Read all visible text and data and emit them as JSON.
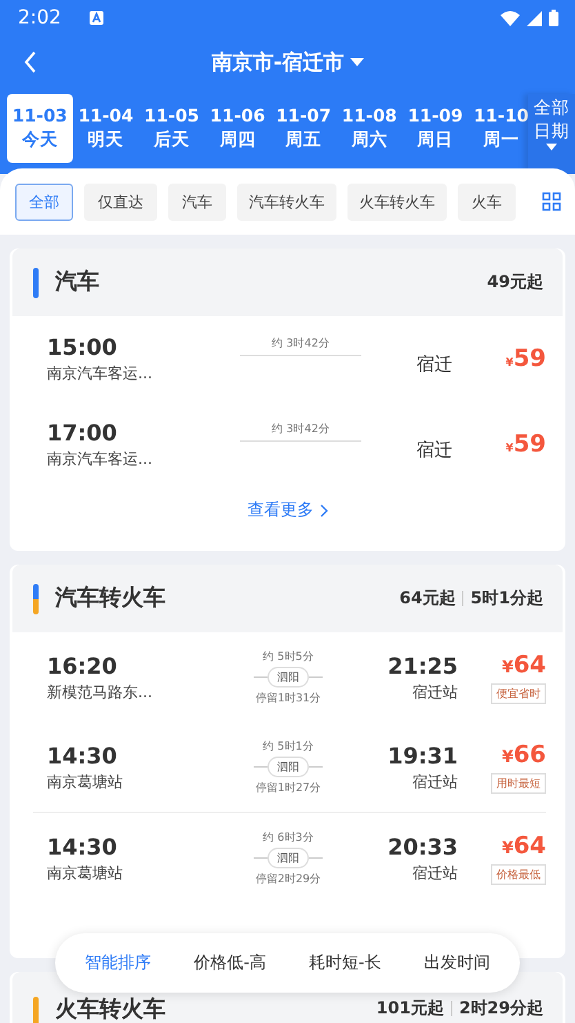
{
  "status_bar": {
    "time": "2:02"
  },
  "header": {
    "title": "南京市-宿迁市"
  },
  "dates": [
    {
      "date": "11-03",
      "day": "今天",
      "selected": true
    },
    {
      "date": "11-04",
      "day": "明天",
      "selected": false
    },
    {
      "date": "11-05",
      "day": "后天",
      "selected": false
    },
    {
      "date": "11-06",
      "day": "周四",
      "selected": false
    },
    {
      "date": "11-07",
      "day": "周五",
      "selected": false
    },
    {
      "date": "11-08",
      "day": "周六",
      "selected": false
    },
    {
      "date": "11-09",
      "day": "周日",
      "selected": false
    },
    {
      "date": "11-10",
      "day": "周一",
      "selected": false
    }
  ],
  "all_dates": {
    "line1": "全部",
    "line2": "日期"
  },
  "filters": [
    {
      "label": "全部",
      "selected": true
    },
    {
      "label": "仅直达",
      "selected": false
    },
    {
      "label": "汽车",
      "selected": false
    },
    {
      "label": "汽车转火车",
      "selected": false
    },
    {
      "label": "火车转火车",
      "selected": false
    },
    {
      "label": "火车",
      "selected": false
    }
  ],
  "sections": [
    {
      "kind": "bus",
      "title": "汽车",
      "markers": [
        {
          "color": "#2f7cf6"
        }
      ],
      "summary": [
        "49元起"
      ],
      "more": "查看更多",
      "rows": [
        {
          "depart": "15:00",
          "station": "南京汽车客运...",
          "duration": "约 3时42分",
          "arrive_city": "宿迁",
          "currency": "¥",
          "price": "59"
        },
        {
          "depart": "17:00",
          "station": "南京汽车客运...",
          "duration": "约 3时42分",
          "arrive_city": "宿迁",
          "currency": "¥",
          "price": "59"
        }
      ]
    },
    {
      "kind": "transfer",
      "title": "汽车转火车",
      "markers": [
        {
          "color": "#2f7cf6"
        },
        {
          "color": "#f5a623"
        }
      ],
      "summary": [
        "64元起",
        "5时1分起"
      ],
      "rows": [
        {
          "depart": "16:20",
          "station": "新模范马路东...",
          "duration": "约 5时5分",
          "via": "泗阳",
          "stopover": "停留1时31分",
          "arrive": "21:25",
          "arrive_station": "宿迁站",
          "currency": "¥",
          "price": "64",
          "tag": "便宜省时"
        },
        {
          "depart": "14:30",
          "station": "南京葛塘站",
          "duration": "约 5时1分",
          "via": "泗阳",
          "stopover": "停留1时27分",
          "arrive": "19:31",
          "arrive_station": "宿迁站",
          "currency": "¥",
          "price": "66",
          "tag": "用时最短"
        },
        {
          "depart": "14:30",
          "station": "南京葛塘站",
          "duration": "约 6时3分",
          "via": "泗阳",
          "stopover": "停留2时29分",
          "arrive": "20:33",
          "arrive_station": "宿迁站",
          "currency": "¥",
          "price": "64",
          "tag": "价格最低"
        }
      ]
    },
    {
      "kind": "partial",
      "title": "火车转火车",
      "markers": [
        {
          "color": "#f5a623"
        }
      ],
      "summary": [
        "101元起",
        "2时29分起"
      ]
    }
  ],
  "sort": [
    {
      "label": "智能排序",
      "selected": true
    },
    {
      "label": "价格低-高",
      "selected": false
    },
    {
      "label": "耗时短-长",
      "selected": false
    },
    {
      "label": "出发时间",
      "selected": false
    }
  ]
}
